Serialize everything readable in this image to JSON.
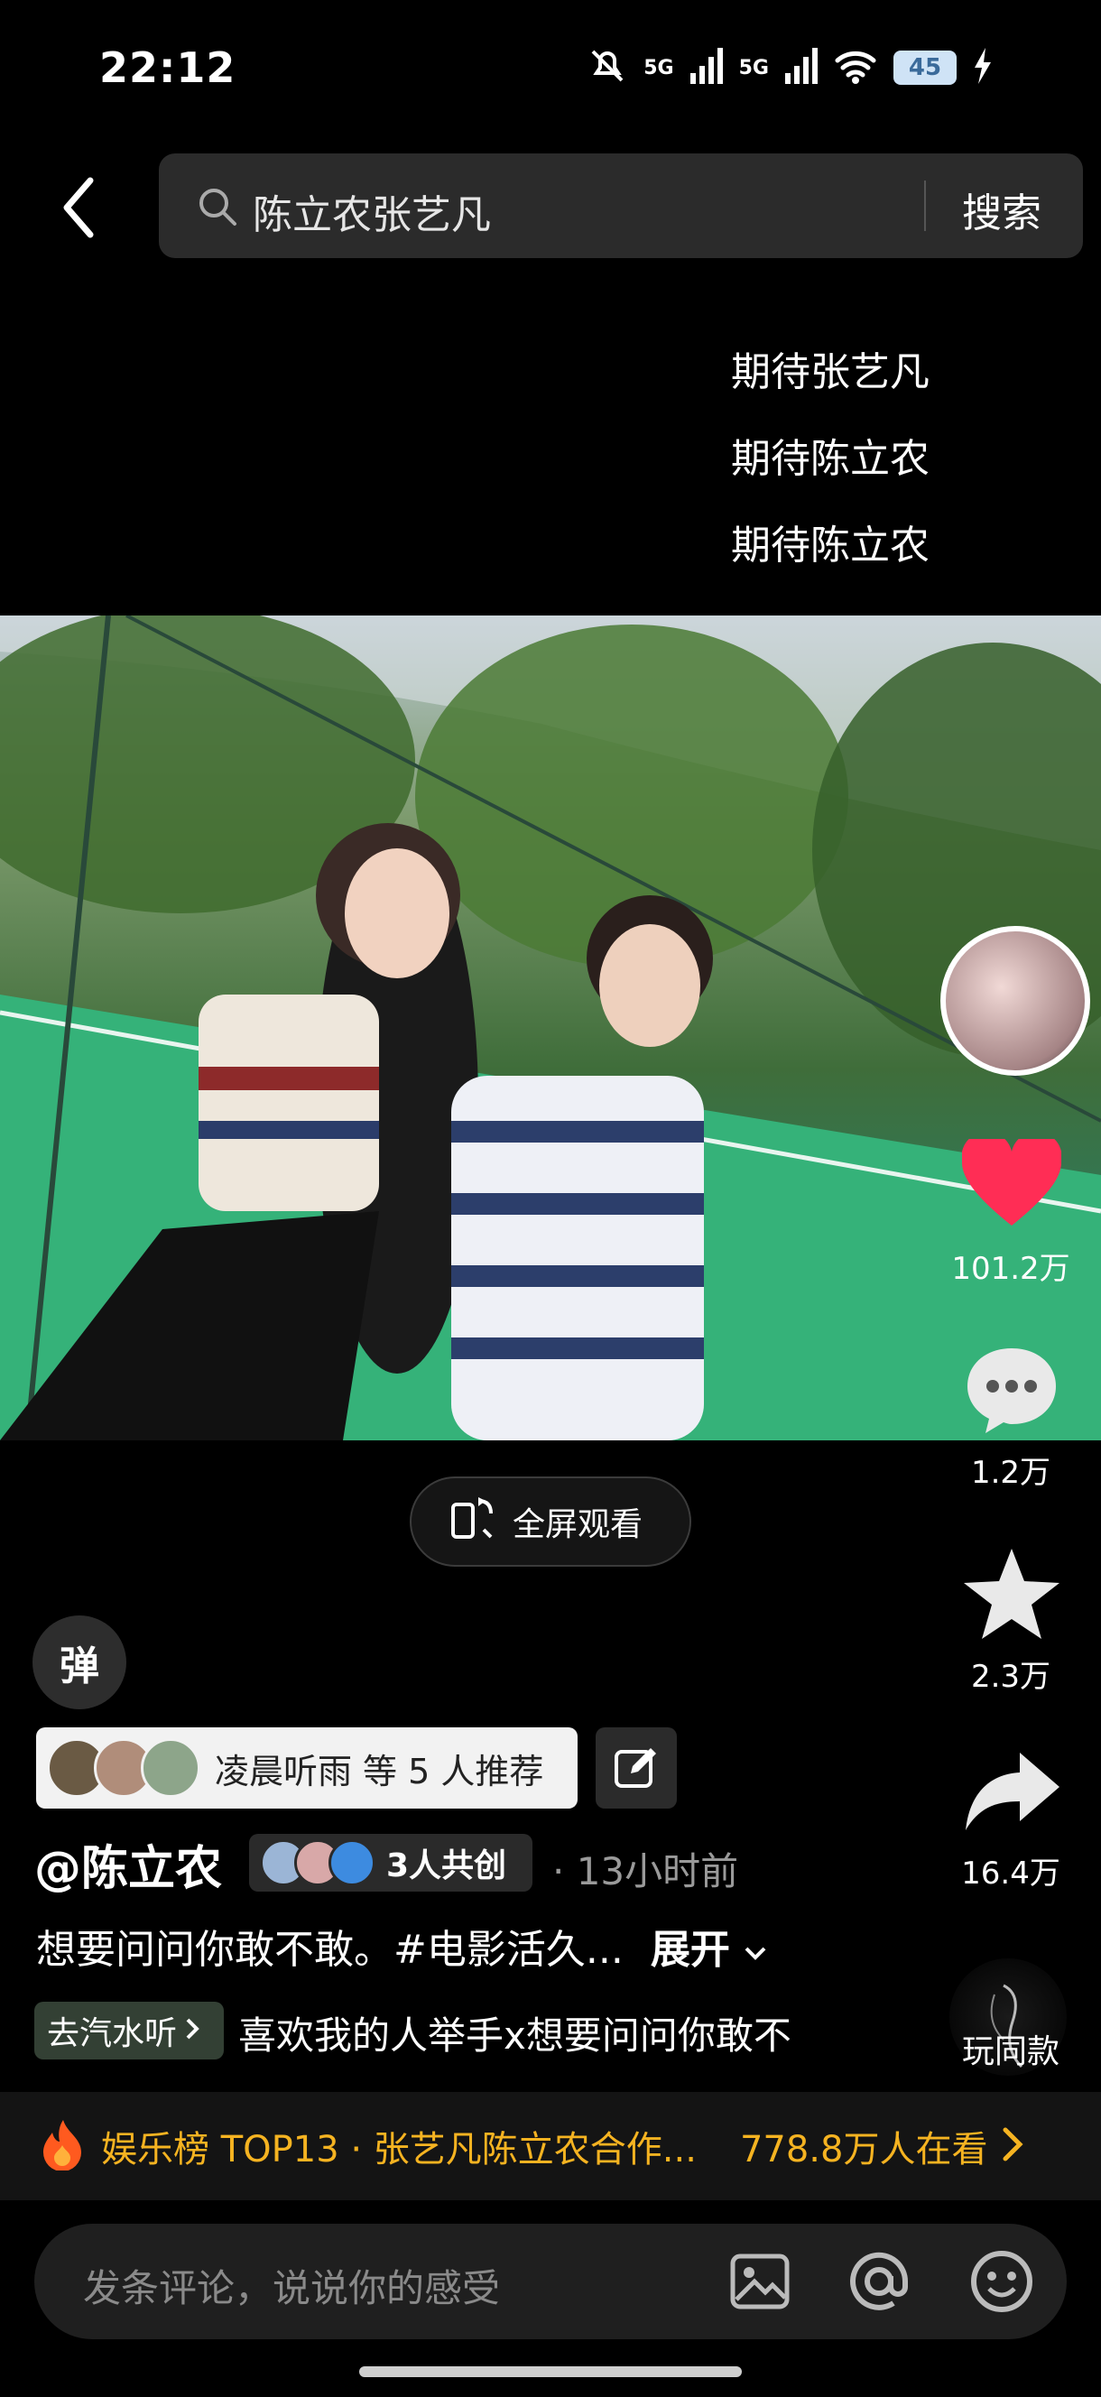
{
  "status_bar": {
    "time": "22:12",
    "signal1": "5G",
    "signal2": "5G",
    "battery": "45"
  },
  "search": {
    "query": "陈立农张艺凡",
    "button": "搜索"
  },
  "danmaku": [
    "期待张艺凡",
    "期待陈立农",
    "期待陈立农"
  ],
  "actions": {
    "likes": "101.2万",
    "comments": "1.2万",
    "favorites": "2.3万",
    "shares": "16.4万",
    "same_style": "玩同款"
  },
  "fullscreen_label": "全屏观看",
  "danmu_toggle": "弹",
  "recommend": {
    "name": "凌晨听雨",
    "suffix": "等 5 人推荐"
  },
  "author": {
    "name": "@陈立农",
    "collab": "3人共创",
    "time_ago": "· 13小时前"
  },
  "description": {
    "text": "想要问问你敢不敢。#电影活久...",
    "expand": "展开"
  },
  "music": {
    "tag": "去汽水听",
    "title": "喜欢我的人举手x想要问问你敢不"
  },
  "hot_bar": {
    "rank": "娱乐榜 TOP13 · 张艺凡陈立农合作...",
    "viewers": "778.8万人在看"
  },
  "comment_input": {
    "placeholder": "发条评论，说说你的感受"
  },
  "colors": {
    "accent": "#f5b321",
    "heart": "#ff2d55"
  }
}
